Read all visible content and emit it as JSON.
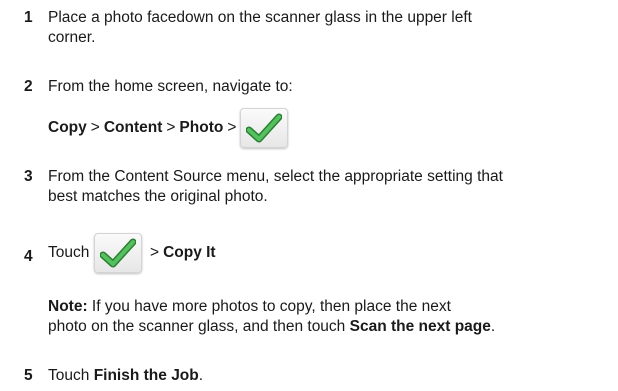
{
  "steps": [
    {
      "num": "1",
      "line1": "Place a photo facedown on the scanner glass in the upper left",
      "line2": "corner."
    },
    {
      "num": "2",
      "text": "From the home screen, navigate to:"
    },
    {
      "num": "3",
      "line1": "From the Content Source menu, select the appropriate setting that",
      "line2": "best matches the original photo."
    },
    {
      "num": "4",
      "prefix": "Touch",
      "suffix_sep": ">",
      "suffix": "Copy It"
    },
    {
      "num": "5",
      "prefix": "Touch",
      "bold": "Finish the Job",
      "end": "."
    }
  ],
  "path": {
    "items": [
      "Copy",
      "Content",
      "Photo"
    ],
    "sep": ">"
  },
  "note": {
    "label": "Note:",
    "text1": "If you have more photos to copy, then place the next",
    "text2": "photo on the scanner glass, and then touch",
    "bold": "Scan the next page",
    "end": "."
  },
  "icons": {
    "check": "checkmark-icon"
  },
  "colors": {
    "check_green": "#3fae49",
    "check_dark": "#2a7f33"
  }
}
